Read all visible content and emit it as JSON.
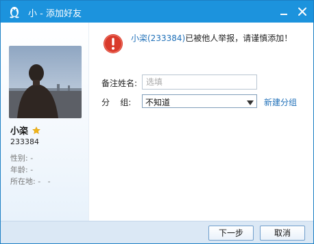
{
  "window": {
    "title": "小 - 添加好友",
    "icon": "qq-penguin-icon",
    "controls": {
      "minimize_icon": "minimize-icon",
      "close_icon": "close-icon"
    },
    "colors": {
      "titlebar": "#1c93dd",
      "link": "#1e6fb8",
      "warning": "#d93a2b",
      "footer": "#dbe8f5"
    }
  },
  "profile": {
    "nickname": "小栥",
    "badge_icon": "star-icon",
    "qq_number": "233384",
    "gender_label": "性别:",
    "gender_value": "-",
    "age_label": "年龄:",
    "age_value": "-",
    "location_label": "所在地:",
    "location_value": "-   -"
  },
  "warning": {
    "icon": "warning-icon",
    "link_text": "小栥(233384)",
    "message": "已被他人举报，请谨慎添加！"
  },
  "form": {
    "remark_label": "备注姓名:",
    "remark_placeholder": "选填",
    "remark_value": "",
    "group_label": "分    组:",
    "group_value": "不知道",
    "new_group_link": "新建分组"
  },
  "buttons": {
    "next": "下一步",
    "cancel": "取消"
  }
}
